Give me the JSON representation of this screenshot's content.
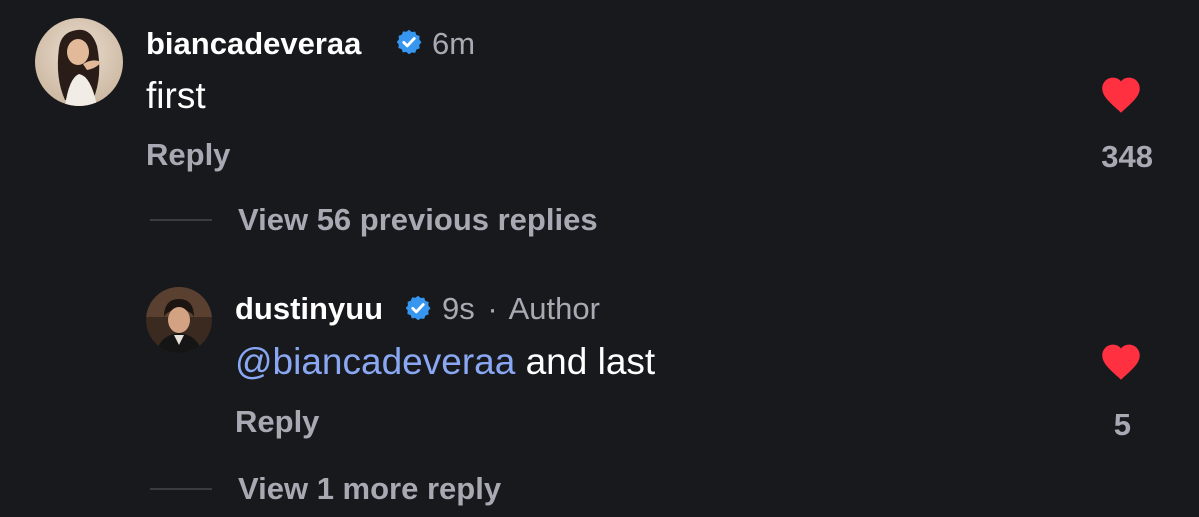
{
  "colors": {
    "background": "#18191d",
    "text_primary": "#ffffff",
    "text_secondary": "#a8aab3",
    "mention": "#8aa7f3",
    "verified_badge": "#3797f0",
    "heart": "#ff3040",
    "thread_line": "#3a3c42"
  },
  "comments": [
    {
      "username": "biancadeveraa",
      "verified": true,
      "timestamp": "6m",
      "text": "first",
      "reply_label": "Reply",
      "likes": "348",
      "liked": true,
      "heart_icon": "heart-filled-icon",
      "avatar_icon": "avatar-photo"
    }
  ],
  "thread": {
    "view_previous_label": "View 56 previous replies",
    "view_more_label": "View 1 more reply"
  },
  "replies": [
    {
      "username": "dustinyuu",
      "verified": true,
      "timestamp": "9s",
      "author_separator": "·",
      "author_label": "Author",
      "mention": "@biancadeveraa",
      "text": "and last",
      "reply_label": "Reply",
      "likes": "5",
      "liked": true,
      "heart_icon": "heart-filled-icon",
      "avatar_icon": "avatar-photo"
    }
  ]
}
